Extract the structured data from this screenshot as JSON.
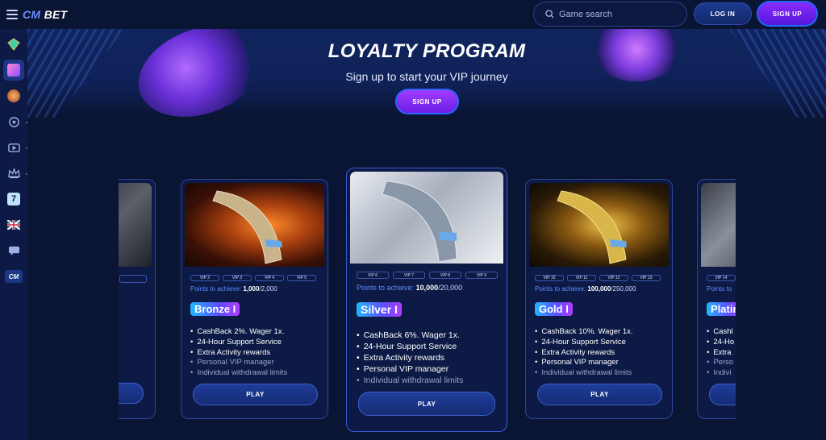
{
  "header": {
    "logo_mark": "CM",
    "logo_text": "BET",
    "search_placeholder": "Game search",
    "login_label": "LOG IN",
    "signup_label": "SIGN UP"
  },
  "sidebar": {
    "items": [
      {
        "name": "gem-icon",
        "color": "#3fd0a8"
      },
      {
        "name": "slots-icon",
        "color": "#e86bd4"
      },
      {
        "name": "live-dealer-icon",
        "color": "#e88a3c"
      },
      {
        "name": "sports-icon",
        "color": "#9fb0e8"
      },
      {
        "name": "video-icon",
        "color": "#9fb0e8"
      },
      {
        "name": "crown-icon",
        "color": "#9fb0e8"
      },
      {
        "name": "seven-icon",
        "color": "#bfe3ff"
      },
      {
        "name": "uk-flag-icon",
        "color": "#cf2a3a"
      },
      {
        "name": "chat-icon",
        "color": "#9fb0e8"
      },
      {
        "name": "cm-logo-icon",
        "color": "#2b6bff"
      }
    ]
  },
  "hero": {
    "title": "LOYALTY PROGRAM",
    "subtitle": "Sign up to start your VIP journey",
    "button_label": "SIGN UP"
  },
  "cards": [
    {
      "id": "bronze",
      "vip_levels": [
        "VIP 2",
        "VIP 3",
        "VIP 4",
        "VIP 5"
      ],
      "points_label": "Points to achieve:",
      "points_current": "1,000",
      "points_total": "/2,000",
      "tier": "Bronze I",
      "perks": [
        "CashBack 2%. Wager 1x.",
        "24-Hour Support Service",
        "Extra Activity rewards",
        "Personal VIP manager",
        "Individual withdrawal limits"
      ],
      "play_label": "PLAY"
    },
    {
      "id": "silver",
      "vip_levels": [
        "VIP 6",
        "VIP 7",
        "VIP 8",
        "VIP 9"
      ],
      "points_label": "Points to achieve:",
      "points_current": "10,000",
      "points_total": "/20,000",
      "tier": "Silver I",
      "perks": [
        "CashBack 6%. Wager 1x.",
        "24-Hour Support Service",
        "Extra Activity rewards",
        "Personal VIP manager",
        "Individual withdrawal limits"
      ],
      "play_label": "PLAY"
    },
    {
      "id": "gold",
      "vip_levels": [
        "VIP 10",
        "VIP 11",
        "VIP 12",
        "VIP 13"
      ],
      "points_label": "Points to achieve:",
      "points_current": "100,000",
      "points_total": "/250,000",
      "tier": "Gold I",
      "perks": [
        "CashBack 10%. Wager 1x.",
        "24-Hour Support Service",
        "Extra Activity rewards",
        "Personal VIP manager",
        "Individual withdrawal limits"
      ],
      "play_label": "PLAY"
    },
    {
      "id": "platinum-partial",
      "vip_levels": [
        "VIP 14"
      ],
      "points_label": "Points to",
      "tier": "Platin",
      "perks": [
        "Cashl",
        "24-Ho",
        "Extra",
        "Perso",
        "Indivi"
      ]
    }
  ],
  "colors": {
    "background": "#0a1433",
    "accent_blue": "#2b6bff",
    "accent_purple": "#8a2bff",
    "points_blue": "#5d8dff"
  }
}
